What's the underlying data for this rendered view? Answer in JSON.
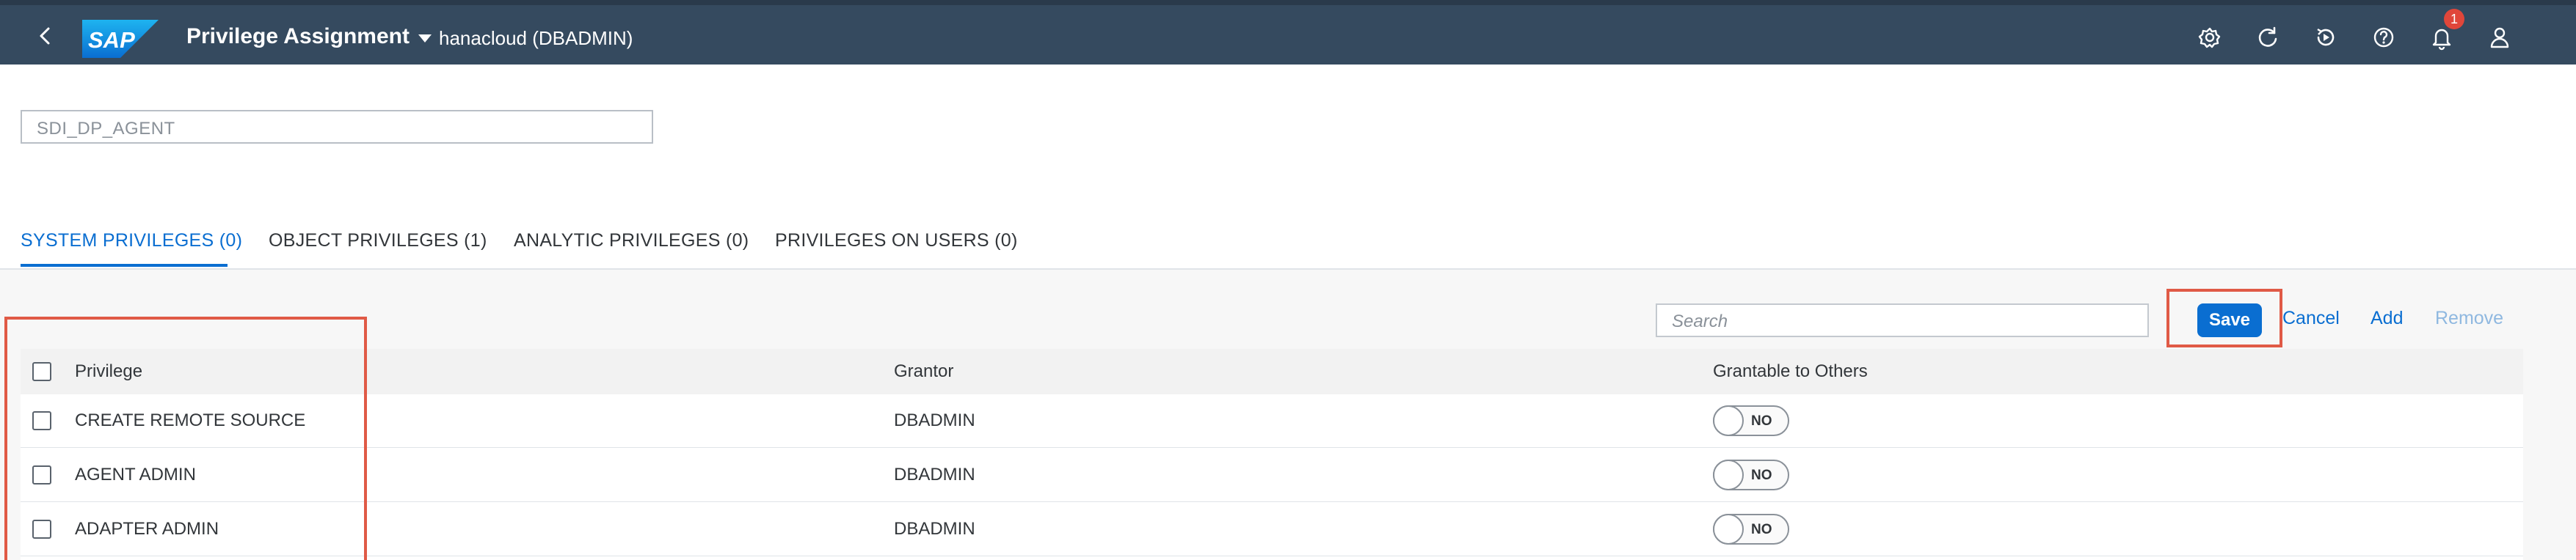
{
  "shell": {
    "title": "Privilege Assignment",
    "system_label": "hanacloud (DBADMIN)",
    "logo_text": "SAP",
    "notification_count": "1",
    "icons": [
      "back-icon",
      "settings-icon",
      "refresh-icon",
      "replay-icon",
      "help-icon",
      "bell-icon",
      "user-icon"
    ]
  },
  "role": {
    "value": "SDI_DP_AGENT"
  },
  "tabs": [
    {
      "label": "SYSTEM PRIVILEGES (0)",
      "active": true
    },
    {
      "label": "OBJECT PRIVILEGES (1)",
      "active": false
    },
    {
      "label": "ANALYTIC PRIVILEGES (0)",
      "active": false
    },
    {
      "label": "PRIVILEGES ON USERS (0)",
      "active": false
    }
  ],
  "toolbar": {
    "search_placeholder": "Search",
    "save_label": "Save",
    "cancel_label": "Cancel",
    "add_label": "Add",
    "remove_label": "Remove"
  },
  "table": {
    "columns": [
      "Privilege",
      "Grantor",
      "Grantable to Others"
    ],
    "rows": [
      {
        "privilege": "CREATE REMOTE SOURCE",
        "grantor": "DBADMIN",
        "grantable": "NO"
      },
      {
        "privilege": "AGENT ADMIN",
        "grantor": "DBADMIN",
        "grantable": "NO"
      },
      {
        "privilege": "ADAPTER ADMIN",
        "grantor": "DBADMIN",
        "grantable": "NO"
      }
    ]
  },
  "colors": {
    "shell_bg": "#354a5f",
    "accent": "#0a6ed1",
    "highlight": "#e05a46",
    "badge": "#e0463a"
  }
}
